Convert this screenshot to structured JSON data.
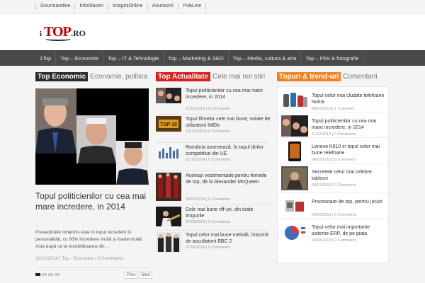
{
  "colors": {
    "col1_tag": "#2b2b2b",
    "col2_tag": "#d9211a",
    "col3_tag": "#f4811f",
    "nav_bg": "#4a4a4a"
  },
  "topbar": {
    "links": [
      "Gourmandine",
      "InfoAfaceri",
      "ImaginiOnline",
      "AnunturiX",
      "PubLine"
    ]
  },
  "logo": {
    "i": "i",
    "top": "TOP",
    "ro": ".RO"
  },
  "nav": {
    "items": [
      "1Top",
      "Top – Economie",
      "Top – IT & Tehnologie",
      "Top – Marketing & SEO",
      "Top – Media, cultura & arta",
      "Top – Film & fotografie"
    ]
  },
  "col1": {
    "tag": "Top Economic",
    "sub": "Economie, politica",
    "feature_title": "Topul politicienilor cu cea mai mare incredere, in 2014",
    "excerpt": "Președintele Iohannis este în topul încrederii în personalități, cu 60% încredere multă și foarte multă. Asta după ce la numărătoarea din ...",
    "meta": "11/12/2014 | Top - Economie | 0 Comments",
    "prev": "Prev",
    "next": "Next"
  },
  "col2": {
    "tag": "Top Actualitate",
    "sub": "Cele mai noi stiri",
    "items": [
      {
        "title": "Topul politicienilor cu cea mai mare incredere, in 2014",
        "meta": "11/12/2014 | 0 Comments",
        "icon": "politicians-thumb"
      },
      {
        "title": "Topul filmelor cele mai bune, votate de utilizatorii IMDb",
        "meta": "10/12/2014 | 0 Comments",
        "icon": "top10-thumb"
      },
      {
        "title": "România avansează, în topul țărilor competitive din UE",
        "meta": "01/10/2014 | 0 Comments",
        "icon": "chart-thumb"
      },
      {
        "title": "Aceeași vestimentatie pentru femeile de top, de la Alexander McQueen",
        "meta": "29/09/2014 | 0 Comments",
        "icon": "fashion-thumb"
      },
      {
        "title": "Cele mai bune riff-uri, din toate timpurile",
        "meta": "27/09/2014 | 0 Comments",
        "icon": "guitar-thumb"
      },
      {
        "title": "Topul celor mai bune melodii, întocmit de ascultatorii BBC 2",
        "meta": "27/09/2014 | 0 Comments",
        "icon": "band-thumb"
      }
    ]
  },
  "col3": {
    "tag": "Topuri & trend-uri",
    "sub": "Comentarii",
    "items": [
      {
        "title": "Topul celor mai cludate telefoane Nokia",
        "meta": "04/03/2013 | 1 Comment",
        "icon": "phones-thumb"
      },
      {
        "title": "Topul politicienilor cu cea mai mare incredere, in 2014",
        "meta": "11/12/2014 | 0 Comments",
        "icon": "politicians-thumb"
      },
      {
        "title": "Lenovo K910 in topul celor mai bune telefoane",
        "meta": "04/03/2013 | 0 Comments",
        "icon": "lenovo-thumb"
      },
      {
        "title": "Secretele celor mai celebre tablouri",
        "meta": "04/03/2013 | 0 Comments",
        "icon": "painting-thumb"
      },
      {
        "title": "Procesoare de top, pentru jocuri",
        "meta": "04/03/2013 | 0 Comments",
        "icon": "cpu-thumb"
      },
      {
        "title": "Topul celor mai importante sisteme ERP, de pe piata",
        "meta": "04/03/2013 | 0 Comments",
        "icon": "erp-thumb"
      }
    ]
  }
}
